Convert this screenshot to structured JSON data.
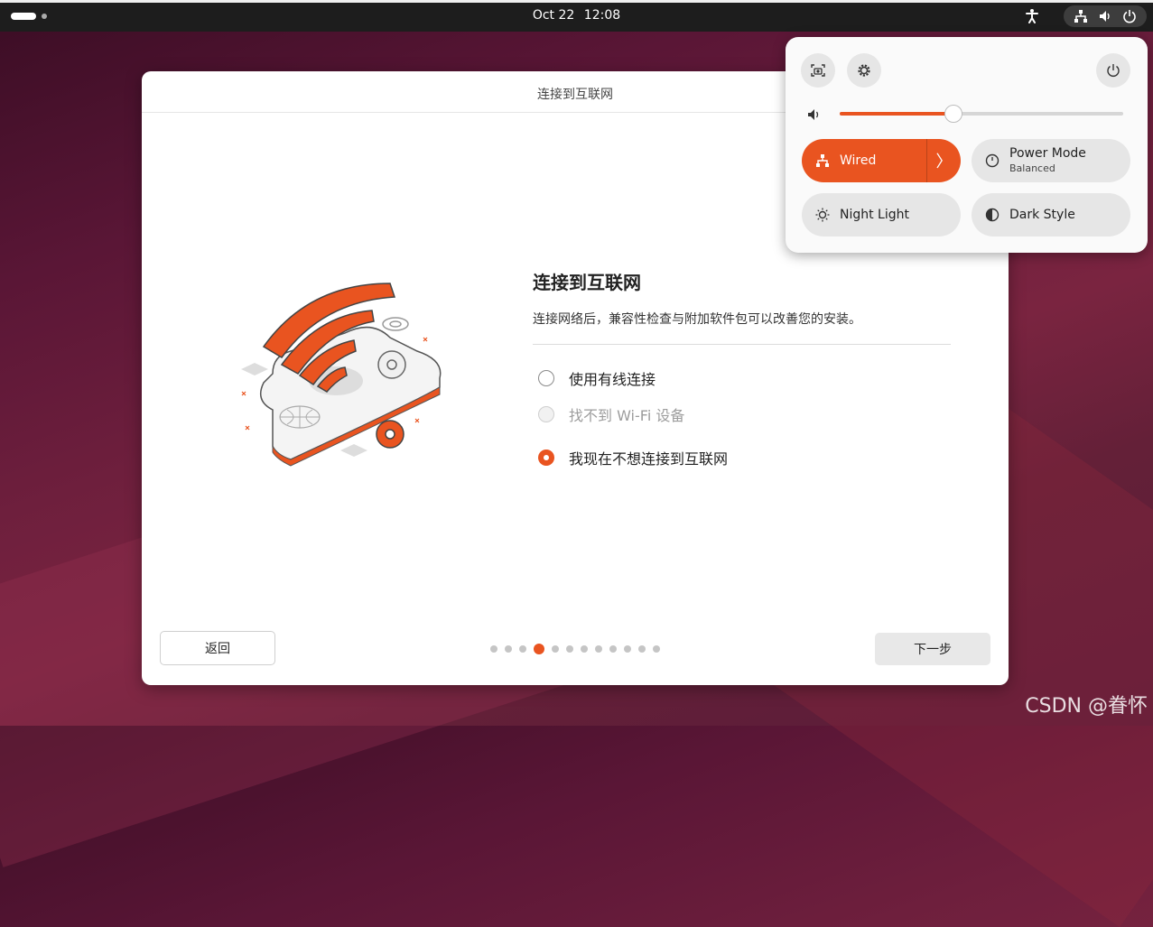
{
  "topbar": {
    "date": "Oct 22",
    "time": "12:08"
  },
  "window": {
    "title": "连接到互联网",
    "heading": "连接到互联网",
    "description": "连接网络后，兼容性检查与附加软件包可以改善您的安装。",
    "options": [
      {
        "label": "使用有线连接",
        "state": "unchecked"
      },
      {
        "label": "找不到 Wi-Fi 设备",
        "state": "disabled"
      },
      {
        "label": "我现在不想连接到互联网",
        "state": "checked"
      }
    ],
    "back_label": "返回",
    "next_label": "下一步",
    "progress": {
      "total_steps": 12,
      "current_step": 4
    }
  },
  "quick_settings": {
    "volume_level": 0.4,
    "tiles": {
      "wired": "Wired",
      "power_mode": "Power Mode",
      "power_mode_value": "Balanced",
      "night_light": "Night Light",
      "dark_style": "Dark Style"
    },
    "accent_color": "#e95420"
  },
  "watermark": "CSDN @眷怀"
}
